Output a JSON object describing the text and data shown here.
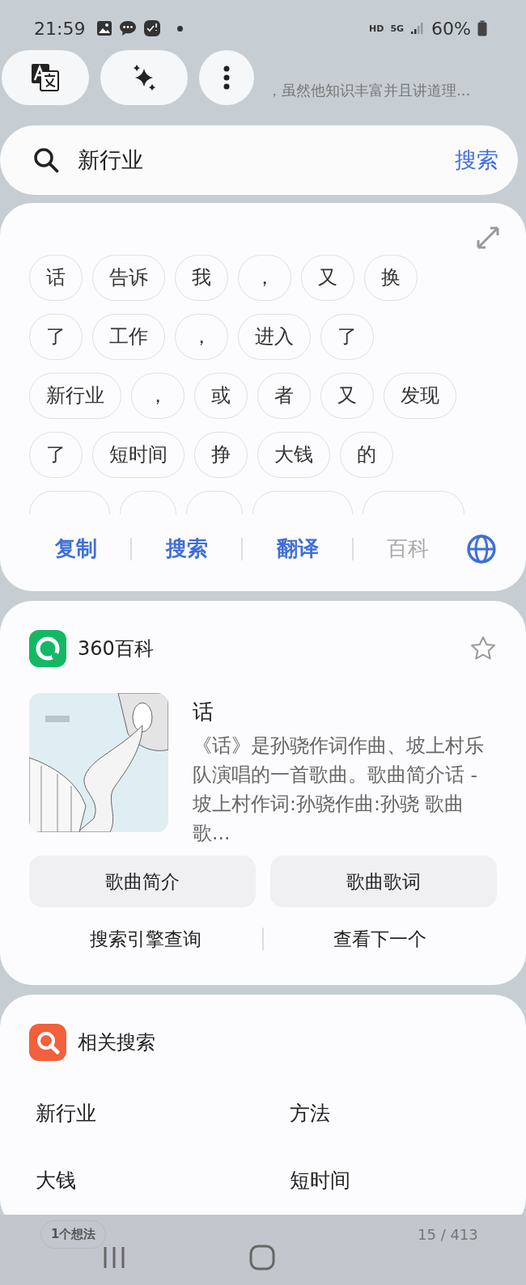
{
  "status_bar": {
    "time": "21:59",
    "hd": "HD",
    "network": "5G",
    "battery": "60%"
  },
  "background_text": "，虽然他知识丰富并且讲道理...",
  "search": {
    "value": "新行业",
    "button": "搜索"
  },
  "chips": [
    [
      "话",
      "告诉",
      "我",
      "，",
      "又",
      "换"
    ],
    [
      "了",
      "工作",
      "，",
      "进入",
      "了"
    ],
    [
      "新行业",
      "，",
      "或",
      "者",
      "又",
      "发现"
    ],
    [
      "了",
      "短时间",
      "挣",
      "大钱",
      "的"
    ]
  ],
  "actions": [
    {
      "label": "复制",
      "disabled": false
    },
    {
      "label": "搜索",
      "disabled": false
    },
    {
      "label": "翻译",
      "disabled": false
    },
    {
      "label": "百科",
      "disabled": true
    }
  ],
  "baike": {
    "source": "360百科",
    "title": "话",
    "description": "《话》是孙骁作词作曲、坡上村乐队演唱的一首歌曲。歌曲简介话 - 坡上村作词:孙骁作曲:孙骁 歌曲歌...",
    "buttons": [
      "歌曲简介",
      "歌曲歌词"
    ],
    "links": [
      "搜索引擎查询",
      "查看下一个"
    ]
  },
  "related": {
    "title": "相关搜索",
    "items": [
      "新行业",
      "方法",
      "大钱",
      "短时间"
    ]
  },
  "footer": {
    "thoughts": "1个想法",
    "page": "15 / 413"
  }
}
